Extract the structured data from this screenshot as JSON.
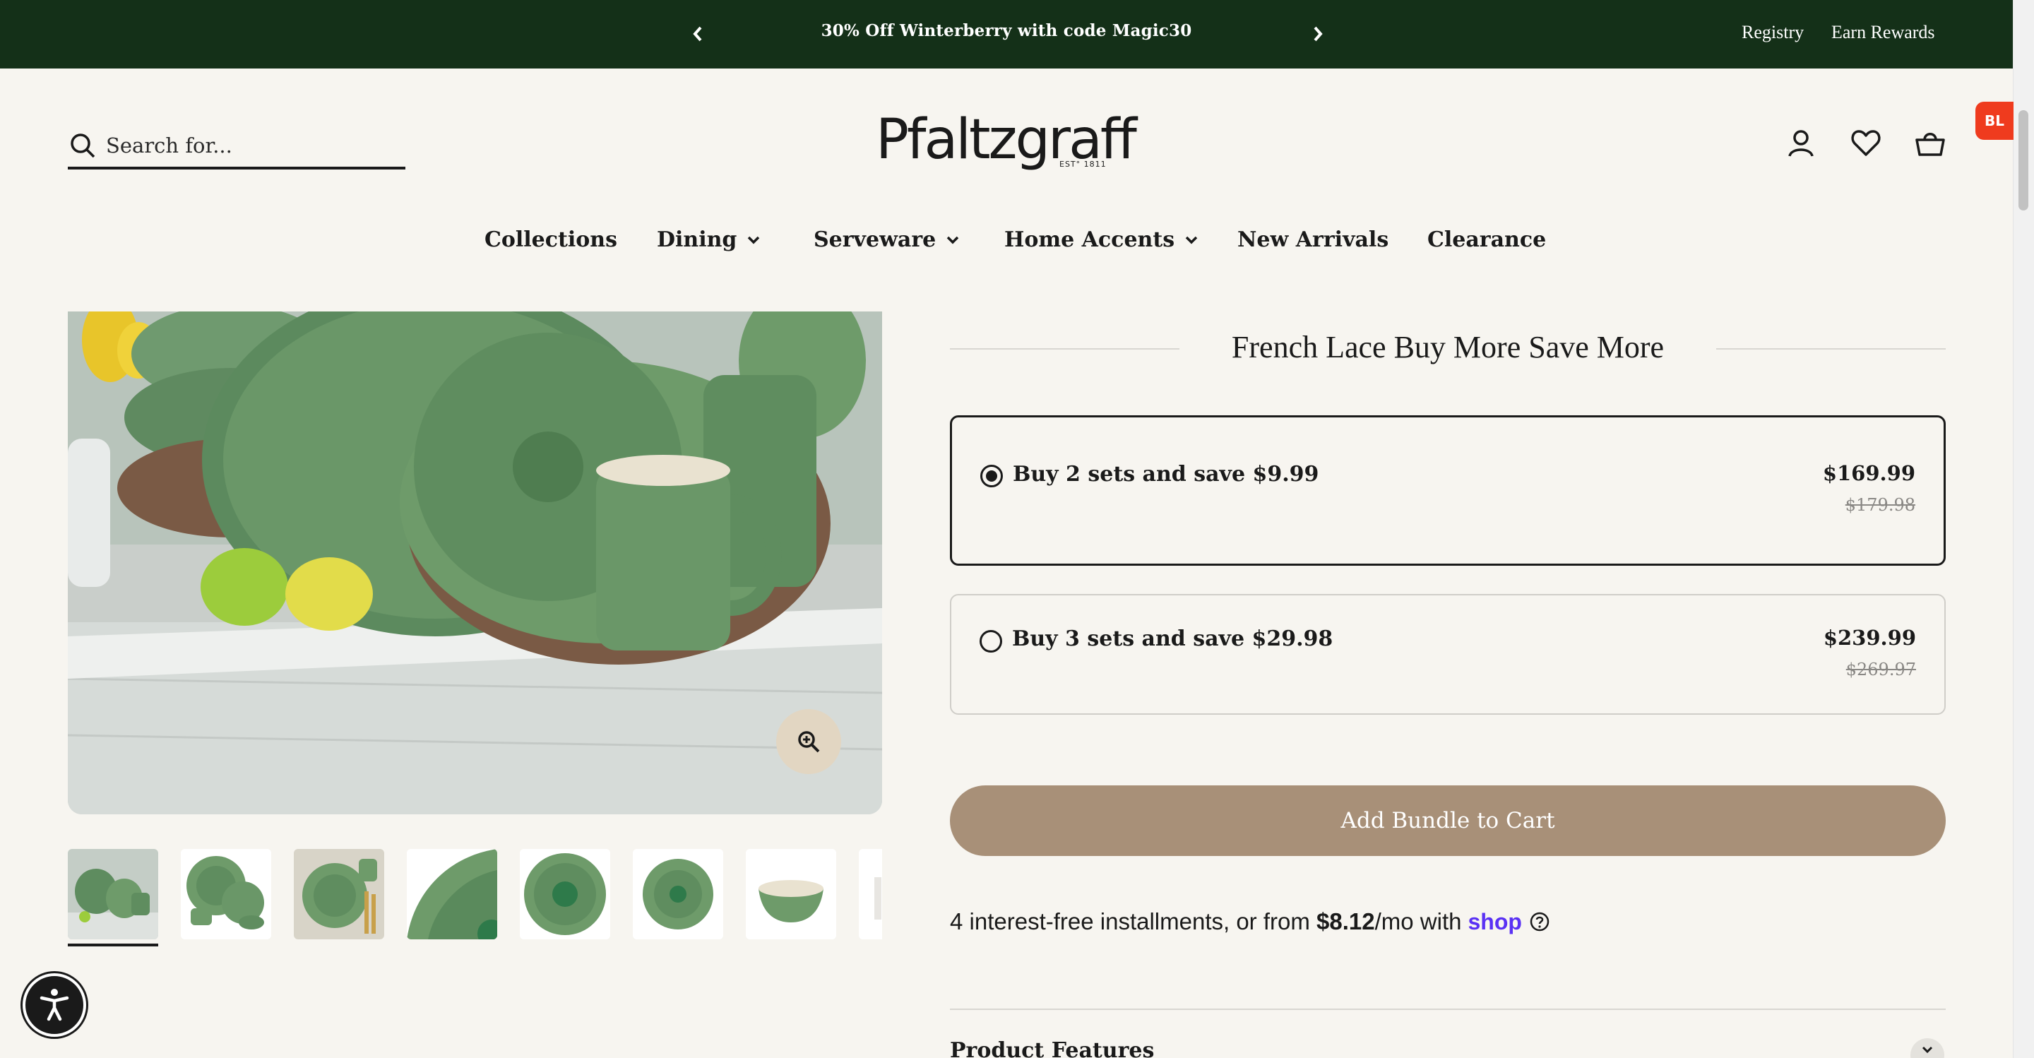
{
  "announcement": {
    "promo": "30% Off Winterberry with code Magic30",
    "registry": "Registry",
    "rewards": "Earn Rewards"
  },
  "header": {
    "search_placeholder": "Search for...",
    "logo": "Pfaltzgraff",
    "logo_sub": "EST° 1811",
    "badge": "BL"
  },
  "nav": {
    "items": [
      {
        "label": "Collections",
        "dropdown": false
      },
      {
        "label": "Dining",
        "dropdown": true
      },
      {
        "label": "Serveware",
        "dropdown": true
      },
      {
        "label": "Home Accents",
        "dropdown": true
      },
      {
        "label": "New Arrivals",
        "dropdown": false
      },
      {
        "label": "Clearance",
        "dropdown": false
      }
    ]
  },
  "bundle": {
    "title": "French Lace Buy More Save More",
    "options": [
      {
        "label": "Buy 2 sets and save $9.99",
        "price": "$169.99",
        "compare": "$179.98",
        "selected": true
      },
      {
        "label": "Buy 3 sets and save $29.98",
        "price": "$239.99",
        "compare": "$269.97",
        "selected": false
      }
    ],
    "button": "Add Bundle to Cart"
  },
  "installments": {
    "prefix": "4 interest-free installments, or from ",
    "amount": "$8.12",
    "suffix": "/mo with",
    "brand": "shop"
  },
  "features": {
    "title": "Product Features"
  },
  "colors": {
    "topbar": "#143018",
    "accent_button": "#a89078",
    "shop_brand": "#5a31f4",
    "badge": "#ef3b1e",
    "background": "#f7f5f0"
  },
  "icons": [
    "chevron-left-icon",
    "chevron-right-icon",
    "search-icon",
    "account-icon",
    "heart-icon",
    "cart-icon",
    "zoom-in-icon",
    "accessibility-icon",
    "help-icon",
    "chevron-down-icon"
  ]
}
